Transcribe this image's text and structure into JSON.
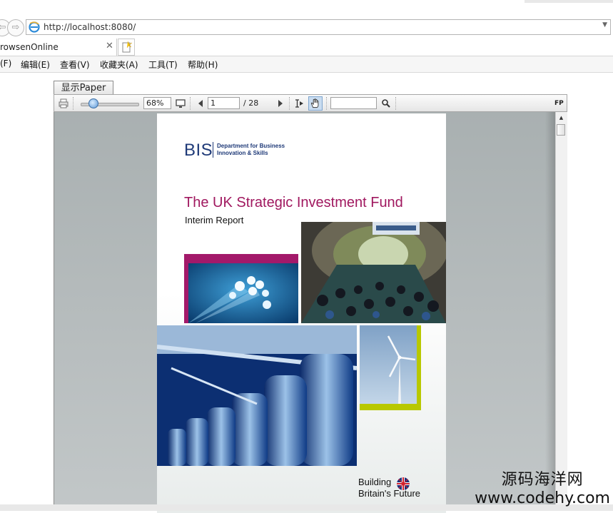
{
  "browser": {
    "address": {
      "url": "http://localhost:8080/"
    },
    "tab": {
      "title": "rowsenOnline"
    },
    "menu": [
      "(F)",
      "编辑(E)",
      "查看(V)",
      "收藏夹(A)",
      "工具(T)",
      "帮助(H)"
    ]
  },
  "viewer": {
    "tab_label": "显示Paper",
    "zoom": "68%",
    "page_current": "1",
    "page_total": "/ 28",
    "search_value": "",
    "brand": "FP"
  },
  "document": {
    "logo_text": "BIS",
    "dept_line1": "Department for Business",
    "dept_line2": "Innovation & Skills",
    "title": "The UK Strategic Investment Fund",
    "subtitle": "Interim Report",
    "footer_line1": "Building",
    "footer_line2": "Britain's Future"
  },
  "watermark": {
    "line1": "源码海洋网",
    "line2": "www.codehy.com"
  },
  "colors": {
    "title_magenta": "#a0185f",
    "bis_blue": "#1f3a78",
    "accent_lime": "#b8c800",
    "magenta_block": "#a3196a"
  }
}
